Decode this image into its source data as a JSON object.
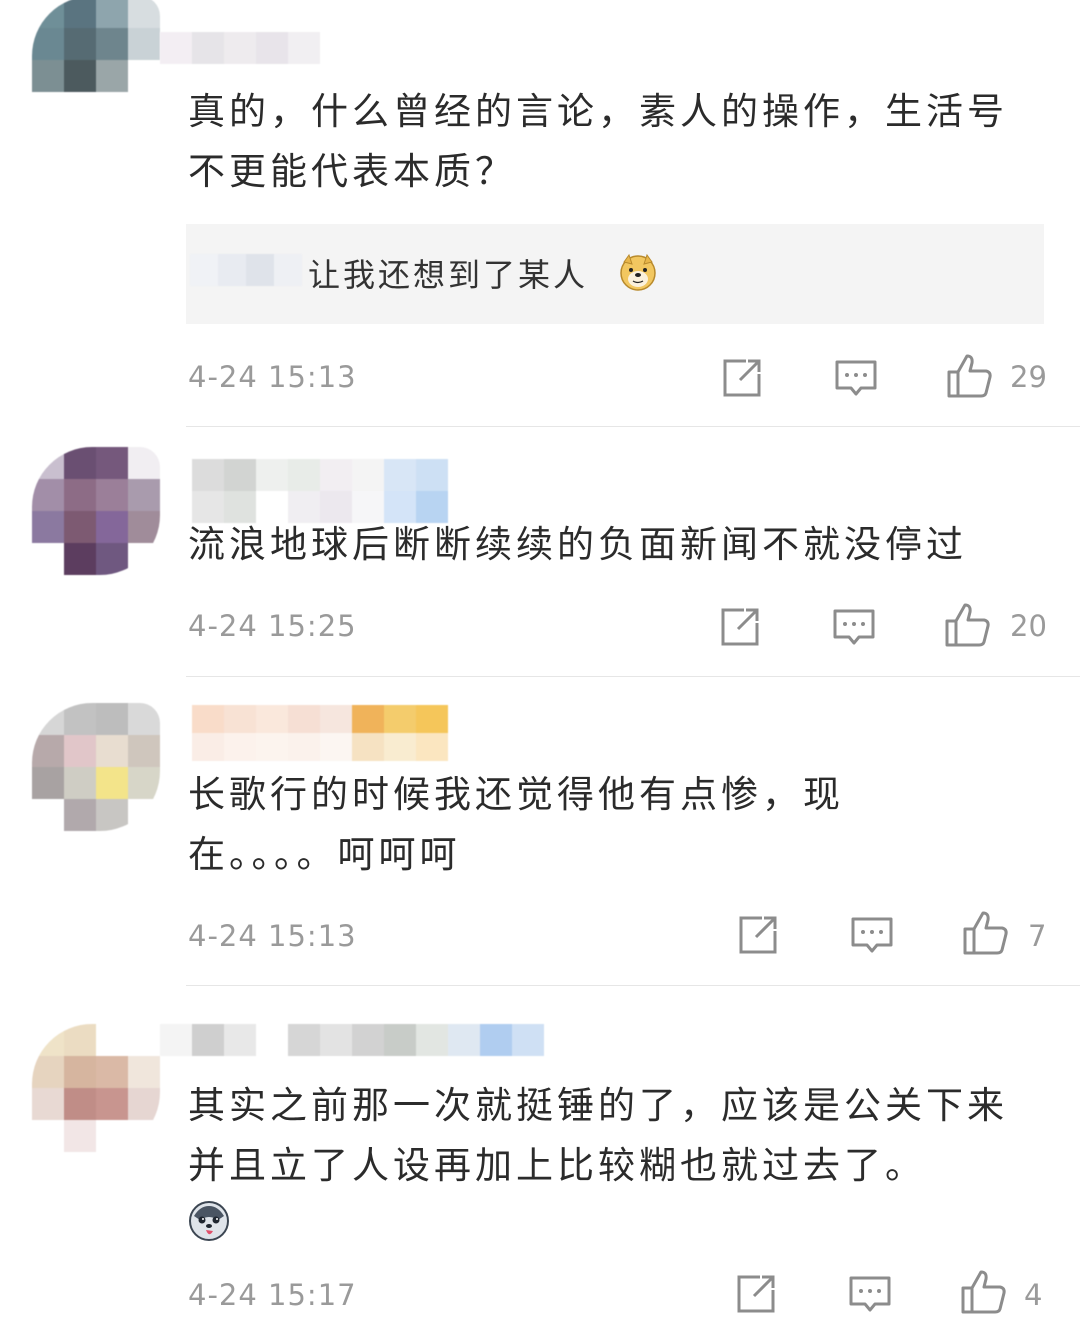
{
  "comments": [
    {
      "text": "真的，什么曾经的言论，素人的操作，生活号不更能代表本质？",
      "quote": {
        "text": "让我还想到了某人"
      },
      "time": "4-24 15:13",
      "likes": "29"
    },
    {
      "text": "流浪地球后断断续续的负面新闻不就没停过",
      "time": "4-24 15:25",
      "likes": "20"
    },
    {
      "text": "长歌行的时候我还觉得他有点惨，现在。。。。呵呵呵",
      "time": "4-24 15:13",
      "likes": "7"
    },
    {
      "text": "其实之前那一次就挺锤的了，应该是公关下来并且立了人设再加上比较糊也就过去了。",
      "time": "4-24 15:17",
      "likes": "4"
    }
  ],
  "icons": {
    "share": "share-icon",
    "reply": "reply-icon",
    "like": "thumbs-up-icon",
    "doge": "doge-emoji-icon",
    "husky": "husky-emoji-icon"
  },
  "colors": {
    "text": "#2b2b2b",
    "meta": "#9a9a9a",
    "quote_bg": "#f4f4f4",
    "divider": "#e6e6e6"
  }
}
